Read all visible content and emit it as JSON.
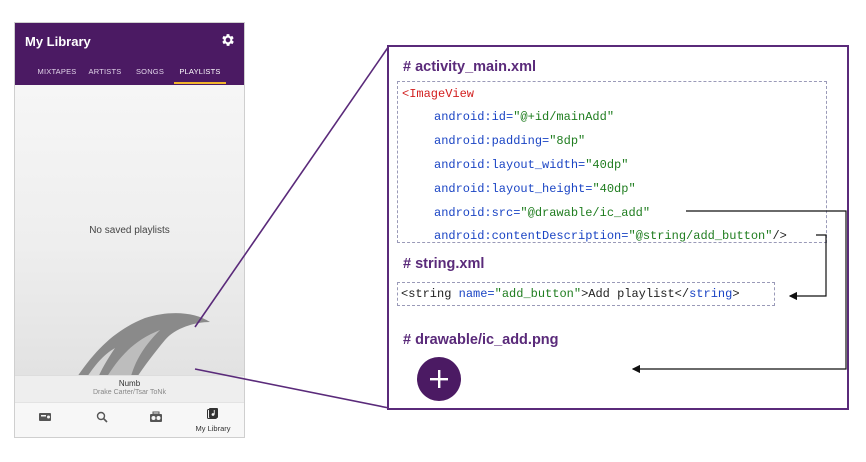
{
  "phone": {
    "app_title": "My Library",
    "tabs": [
      "MIXTAPES",
      "ARTISTS",
      "SONGS",
      "PLAYLISTS"
    ],
    "active_tab": "PLAYLISTS",
    "empty_message": "No saved playlists",
    "now_playing": {
      "title": "Numb",
      "artist": "Drake Carter/Tsar ToNk"
    },
    "bottom_nav": [
      {
        "icon": "radio-icon",
        "label": ""
      },
      {
        "icon": "search-icon",
        "label": ""
      },
      {
        "icon": "boombox-icon",
        "label": ""
      },
      {
        "icon": "library-icon",
        "label": "My Library"
      }
    ],
    "colors": {
      "primary": "#4b1a63",
      "accent": "#f1b52c"
    }
  },
  "panel": {
    "sections": [
      {
        "title": "# activity_main.xml"
      },
      {
        "title": "# string.xml"
      },
      {
        "title": "# drawable/ic_add.png"
      }
    ],
    "activity_xml": {
      "open_tag": "<ImageView",
      "attrs": [
        {
          "name": "android:id=",
          "value": "\"@+id/mainAdd\"",
          "tail": ""
        },
        {
          "name": "android:padding=",
          "value": "\"8dp\"",
          "tail": ""
        },
        {
          "name": "android:layout_width=",
          "value": "\"40dp\"",
          "tail": ""
        },
        {
          "name": "android:layout_height=",
          "value": "\"40dp\"",
          "tail": ""
        },
        {
          "name": "android:src=",
          "value": "\"@drawable/ic_add\"",
          "tail": ""
        },
        {
          "name": "android:contentDescription=",
          "value": "\"@string/add_button\"",
          "tail": "/>"
        }
      ]
    },
    "string_xml": {
      "open": "<string",
      "attr": " name=",
      "value": "\"add_button\"",
      "text": ">Add playlist</",
      "close_tag": "string",
      "end": ">"
    },
    "colors": {
      "border": "#5a2a7a",
      "tag": "#d21f1f",
      "attr": "#1a44c4",
      "value": "#1f7d1f"
    }
  }
}
